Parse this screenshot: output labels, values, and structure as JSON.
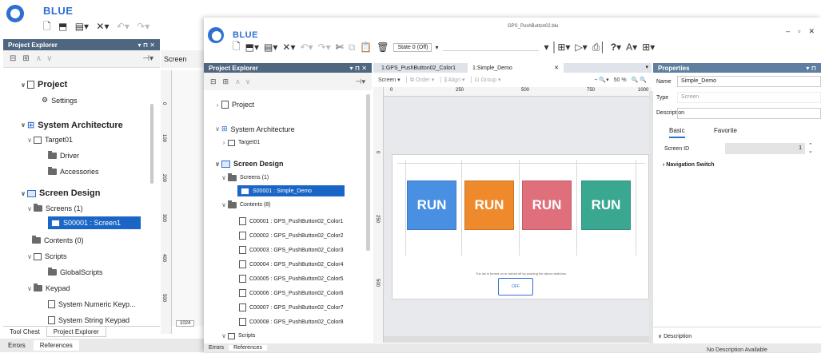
{
  "back_window": {
    "brand": "BLUE",
    "panel_title": "Project Explorer",
    "pin": "▾ ⊓ ✕",
    "screen_label": "Screen",
    "tree": {
      "project": "Project",
      "settings": "Settings",
      "system_architecture": "System Architecture",
      "target": "Target01",
      "driver": "Driver",
      "accessories": "Accessories",
      "screen_design": "Screen Design",
      "screens": "Screens (1)",
      "screen1": "S00001 : Screen1",
      "contents": "Contents (0)",
      "scripts": "Scripts",
      "global_scripts": "GlobalScripts",
      "keypad": "Keypad",
      "numeric_keypad": "System Numeric Keyp...",
      "string_keypad": "System String Keypad"
    },
    "bottom_tabs": [
      "Tool Chest",
      "Project Explorer"
    ],
    "status_tabs": [
      "Errors",
      "References"
    ],
    "ruler_marks": [
      "0",
      "100",
      "200",
      "300",
      "400",
      "500",
      "600"
    ],
    "ruler_bottom": "1024"
  },
  "front_window": {
    "title": "GPS_PushButton02.blu",
    "brand": "BLUE",
    "state_label": "State 0 (Off)",
    "win_controls": [
      "–",
      "▫",
      "✕"
    ],
    "explorer": {
      "title": "Project Explorer",
      "pin": "▾ ⊓ ✕",
      "project": "Project",
      "system_architecture": "System Architecture",
      "target": "Target01",
      "screen_design": "Screen Design",
      "screens": "Screens (1)",
      "screen_item": "S00001 : Simple_Demo",
      "contents": "Contents (8)",
      "content_items": [
        "C00001 : GPS_PushButton02_Color1",
        "C00002 : GPS_PushButton02_Color2",
        "C00003 : GPS_PushButton02_Color3",
        "C00004 : GPS_PushButton02_Color4",
        "C00005 : GPS_PushButton02_Color5",
        "C00006 : GPS_PushButton02_Color6",
        "C00007 : GPS_PushButton02_Color7",
        "C00008 : GPS_PushButton02_Color8"
      ],
      "scripts": "Scripts"
    },
    "doc_tabs": [
      "1:GPS_PushButton02_Color1",
      "1:Simple_Demo"
    ],
    "canvas_toolbar": {
      "screen": "Screen",
      "order": "Order",
      "align": "Align",
      "group": "Group",
      "zoom": "50 %"
    },
    "ruler": [
      "0",
      "250",
      "500",
      "750",
      "1000"
    ],
    "ruler_v": [
      "0",
      "250",
      "500"
    ],
    "run_buttons": [
      {
        "label": "RUN",
        "color": "#4a90e2"
      },
      {
        "label": "RUN",
        "color": "#ef8a2c"
      },
      {
        "label": "RUN",
        "color": "#e06f7c"
      },
      {
        "label": "RUN",
        "color": "#3aa891"
      }
    ],
    "hint_text": "The list is turned on or turned off by pushing the above switches.",
    "off_button": "OFF",
    "properties": {
      "title": "Properties",
      "name_label": "Name",
      "name_value": "Simple_Demo",
      "type_label": "Type",
      "type_value": "Screen",
      "desc_label": "Description",
      "tab_basic": "Basic",
      "tab_favorite": "Favorite",
      "screen_id_label": "Screen ID",
      "screen_id_value": "1",
      "nav_switch": "Navigation Switch",
      "description_section": "Description",
      "no_description": "No Description Available"
    },
    "status_tabs": [
      "Errors",
      "References"
    ]
  }
}
